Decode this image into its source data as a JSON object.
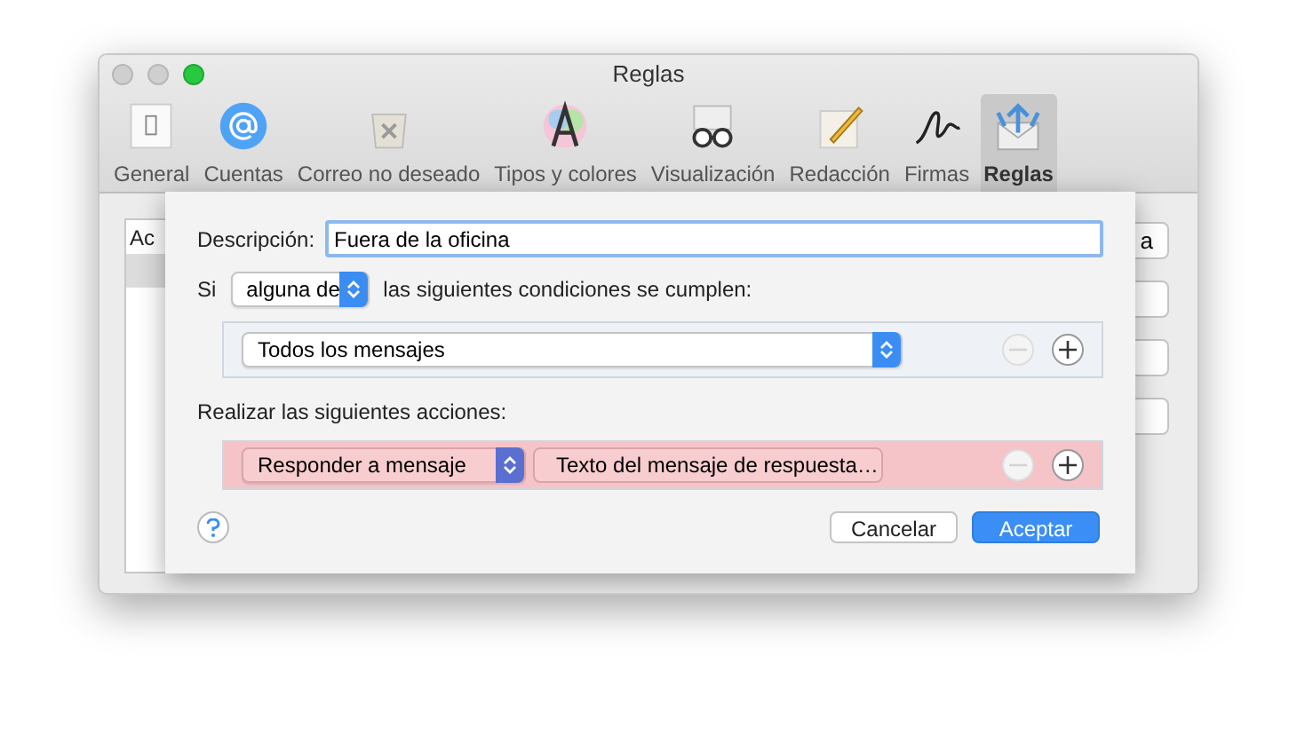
{
  "window": {
    "title": "Reglas"
  },
  "toolbar": [
    {
      "label": "General",
      "selected": false
    },
    {
      "label": "Cuentas",
      "selected": false
    },
    {
      "label": "Correo no deseado",
      "selected": false
    },
    {
      "label": "Tipos y colores",
      "selected": false
    },
    {
      "label": "Visualización",
      "selected": false
    },
    {
      "label": "Redacción",
      "selected": false
    },
    {
      "label": "Firmas",
      "selected": false
    },
    {
      "label": "Reglas",
      "selected": true
    }
  ],
  "background": {
    "list_header": "Ac",
    "button_label": "a"
  },
  "sheet": {
    "description_label": "Descripción:",
    "description_value": "Fuera de la oficina",
    "condition_prefix": "Si",
    "match_popup": "alguna de",
    "condition_suffix": "las siguientes condiciones se cumplen:",
    "conditions": [
      {
        "popup": "Todos los mensajes",
        "remove_disabled": true
      }
    ],
    "actions_label": "Realizar las siguientes acciones:",
    "actions": [
      {
        "popup": "Responder a mensaje",
        "button": "Texto del mensaje de respuesta…",
        "remove_disabled": true
      }
    ],
    "buttons": [
      {
        "label": "Cancelar",
        "default": false
      },
      {
        "label": "Aceptar",
        "default": true
      }
    ]
  }
}
